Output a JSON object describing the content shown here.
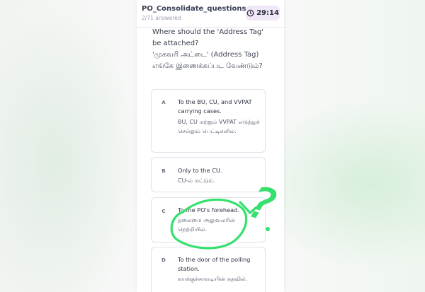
{
  "header": {
    "title": "PO_Consolidate_questions",
    "progress": "2/71 answered",
    "timer": "29:14"
  },
  "question": {
    "text_en": "Where should the 'Address Tag' be attached?",
    "text_ta": "'முகவரி அட்டை' (Address Tag) எங்கே இணைக்கப்பட வேண்டும்?"
  },
  "options": [
    {
      "letter": "A",
      "text_en": "To the BU, CU, and VVPAT carrying cases.",
      "text_ta": "BU, CU மற்றும் VVPAT எடுத்துச் செல்லும் பெட்டிகளில்."
    },
    {
      "letter": "B",
      "text_en": "Only to the CU.",
      "text_ta": "CU-ல் மட்டும்."
    },
    {
      "letter": "C",
      "text_en": "To the PO's forehead.",
      "text_ta": "தலைமை அலுவலரின் நெற்றியில்."
    },
    {
      "letter": "D",
      "text_en": "To the door of the polling station.",
      "text_ta": "வாக்குச்சாவடியின் கதவில்."
    }
  ],
  "annotation": {
    "mark": "?",
    "color": "#35e06f"
  },
  "colors": {
    "timer_bg": "#f0e7f7",
    "card_border": "#dfe2ea",
    "text": "#2f3445"
  }
}
